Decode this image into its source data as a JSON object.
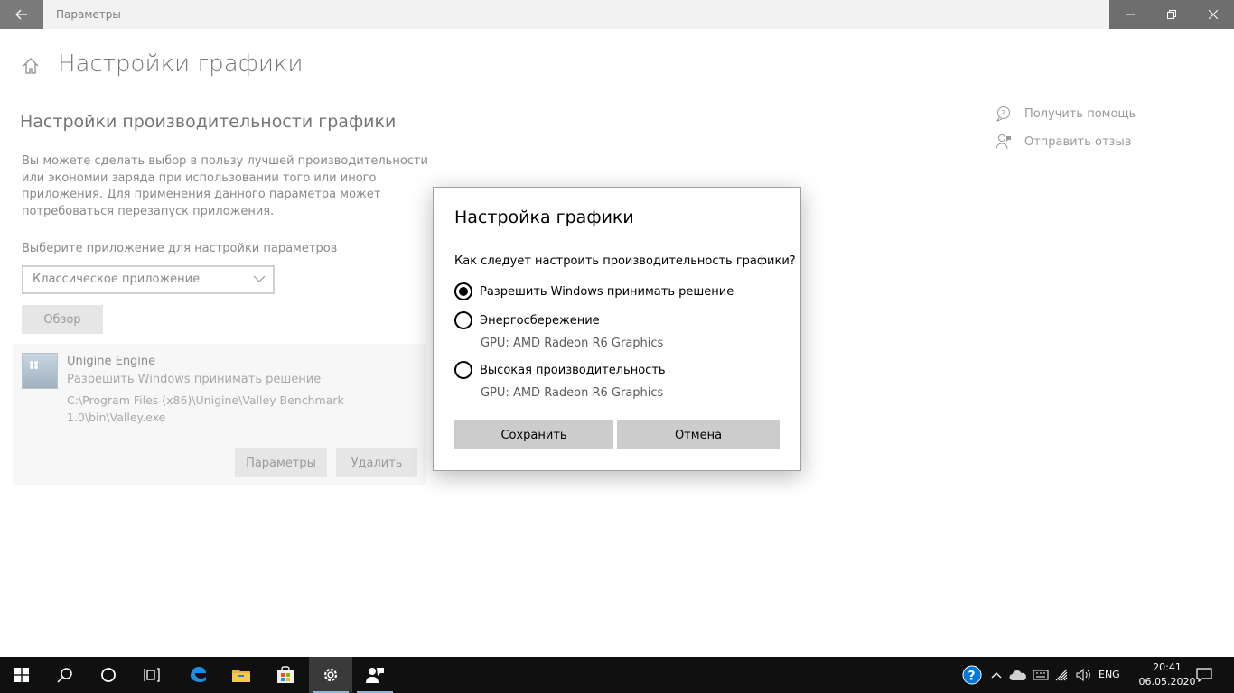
{
  "window": {
    "title": "Параметры"
  },
  "page": {
    "title": "Настройки графики",
    "section_title": "Настройки производительности графики",
    "description": "Вы можете сделать выбор в пользу лучшей производительности или экономии заряда при использовании того или иного приложения. Для применения данного параметра может потребоваться перезапуск приложения.",
    "choose_label": "Выберите приложение для настройки параметров",
    "app_type_select": "Классическое приложение",
    "browse_label": "Обзор"
  },
  "app_entry": {
    "name": "Unigine Engine",
    "mode": "Разрешить Windows принимать решение",
    "path": "C:\\Program Files (x86)\\Unigine\\Valley Benchmark 1.0\\bin\\Valley.exe",
    "params_label": "Параметры",
    "remove_label": "Удалить"
  },
  "help": {
    "get_help": "Получить помощь",
    "feedback": "Отправить отзыв"
  },
  "dialog": {
    "title": "Настройка графики",
    "question": "Как следует настроить производительность графики?",
    "options": [
      {
        "label": "Разрешить Windows принимать решение",
        "checked": true
      },
      {
        "label": "Энергосбережение",
        "gpu": "GPU: AMD Radeon R6 Graphics",
        "checked": false
      },
      {
        "label": "Высокая производительность",
        "gpu": "GPU: AMD Radeon R6 Graphics",
        "checked": false
      }
    ],
    "save_label": "Сохранить",
    "cancel_label": "Отмена"
  },
  "taskbar": {
    "language": "ENG",
    "time": "20:41",
    "date": "06.05.2020",
    "accent_color": "#0078d7"
  }
}
